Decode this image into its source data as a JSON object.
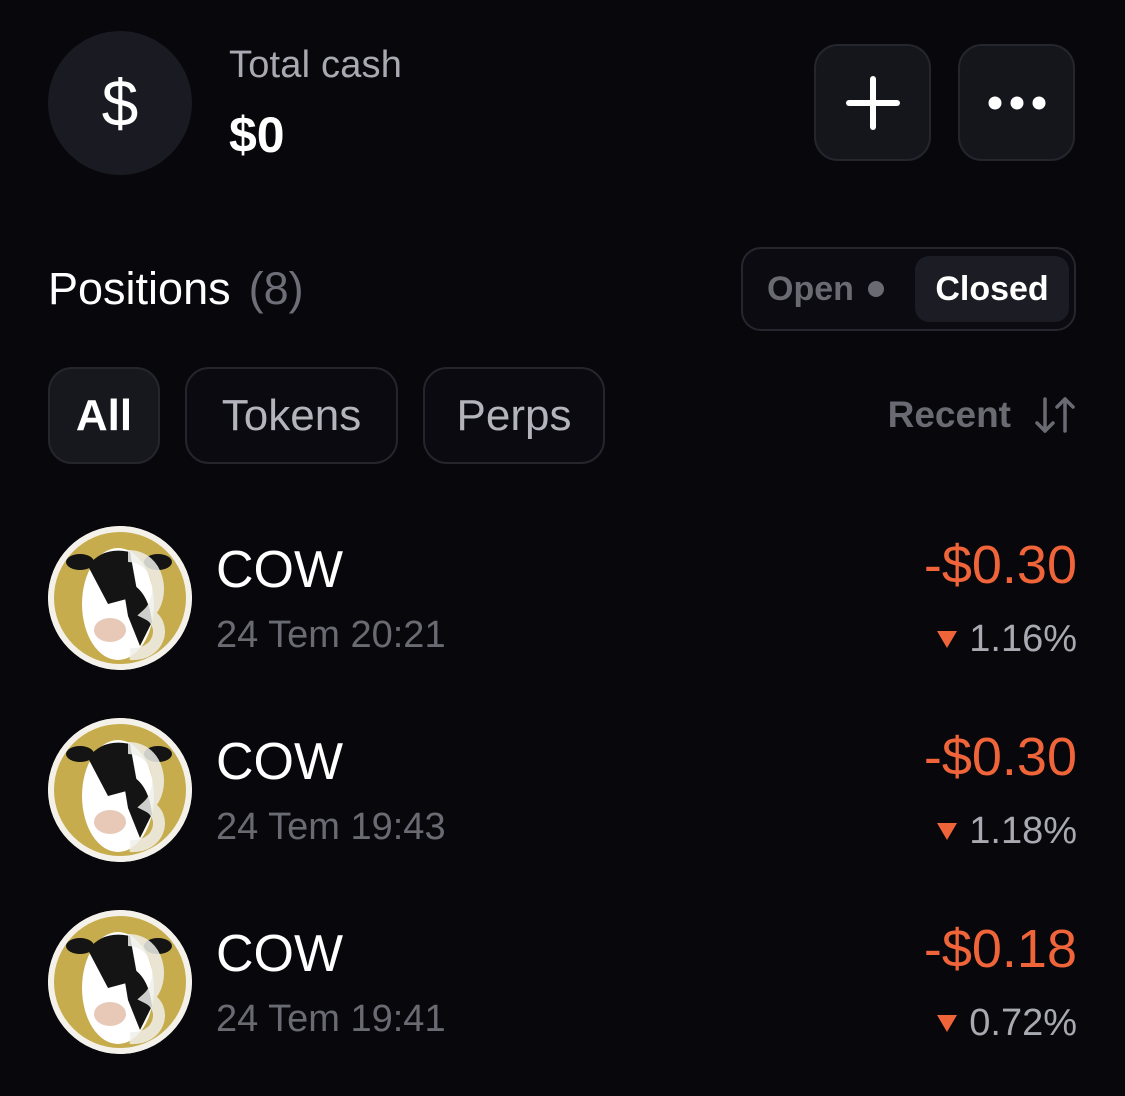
{
  "header": {
    "cash_icon": "$",
    "label": "Total cash",
    "value": "$0",
    "add_icon": "plus-icon",
    "more_icon": "more-horizontal-icon"
  },
  "positions": {
    "title": "Positions",
    "count": "(8)",
    "toggle": {
      "open_label": "Open",
      "closed_label": "Closed",
      "selected": "Closed"
    },
    "filters": {
      "all": "All",
      "tokens": "Tokens",
      "perps": "Perps",
      "selected": "All"
    },
    "sort": {
      "label": "Recent",
      "icon": "sort-arrows-icon"
    },
    "items": [
      {
        "name": "COW",
        "date": "24 Tem 20:21",
        "pnl": "-$0.30",
        "pct": "1.16%",
        "direction": "down"
      },
      {
        "name": "COW",
        "date": "24 Tem 19:43",
        "pnl": "-$0.30",
        "pct": "1.18%",
        "direction": "down"
      },
      {
        "name": "COW",
        "date": "24 Tem 19:41",
        "pnl": "-$0.18",
        "pct": "0.72%",
        "direction": "down"
      }
    ]
  },
  "colors": {
    "background": "#07070c",
    "loss": "#f0643a",
    "muted": "#6a6a73",
    "coin_gold": "#c6ac4c"
  }
}
